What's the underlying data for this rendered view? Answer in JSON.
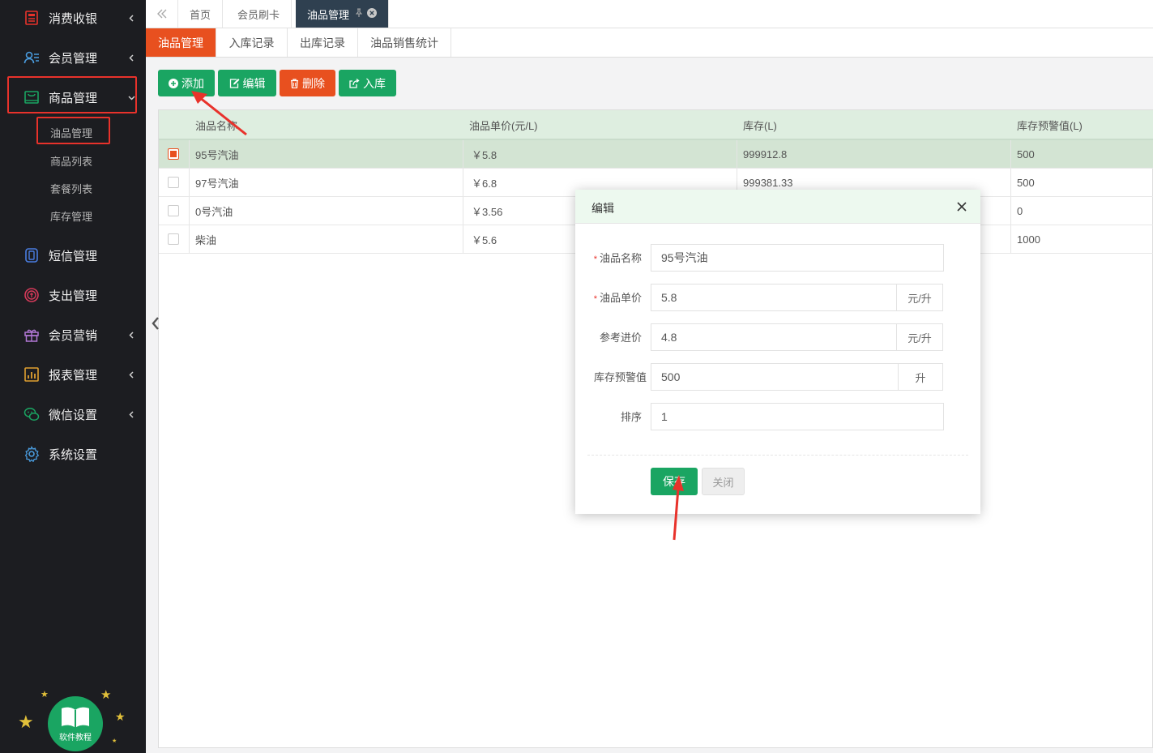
{
  "sidebar": {
    "items": [
      {
        "label": "消费收银",
        "icon": "cash-register-icon"
      },
      {
        "label": "会员管理",
        "icon": "member-icon"
      },
      {
        "label": "商品管理",
        "icon": "goods-icon"
      },
      {
        "label": "短信管理",
        "icon": "sms-icon"
      },
      {
        "label": "支出管理",
        "icon": "expense-icon"
      },
      {
        "label": "会员营销",
        "icon": "gift-icon"
      },
      {
        "label": "报表管理",
        "icon": "report-icon"
      },
      {
        "label": "微信设置",
        "icon": "wechat-icon"
      },
      {
        "label": "系统设置",
        "icon": "gear-icon"
      }
    ],
    "sub_items": [
      "油品管理",
      "商品列表",
      "套餐列表",
      "库存管理"
    ],
    "tutorial_label": "软件教程"
  },
  "top_tabs": [
    "首页",
    "会员刷卡",
    "油品管理"
  ],
  "sub_tabs": [
    "油品管理",
    "入库记录",
    "出库记录",
    "油品销售统计"
  ],
  "toolbar": {
    "add_label": "添加",
    "edit_label": "编辑",
    "delete_label": "删除",
    "stock_in_label": "入库"
  },
  "table": {
    "headers": [
      "油品名称",
      "油品单价(元/L)",
      "库存(L)",
      "库存预警值(L)"
    ],
    "rows": [
      {
        "name": "95号汽油",
        "price": "￥5.8",
        "stock": "999912.8",
        "warning": "500",
        "selected": true
      },
      {
        "name": "97号汽油",
        "price": "￥6.8",
        "stock": "999381.33",
        "warning": "500",
        "selected": false
      },
      {
        "name": "0号汽油",
        "price": "￥3.56",
        "stock": "",
        "warning": "0",
        "selected": false
      },
      {
        "name": "柴油",
        "price": "￥5.6",
        "stock": "",
        "warning": "1000",
        "selected": false
      }
    ]
  },
  "modal": {
    "title": "编辑",
    "fields": [
      {
        "label": "油品名称",
        "value": "95号汽油",
        "required": true,
        "suffix": ""
      },
      {
        "label": "油品单价",
        "value": "5.8",
        "required": true,
        "suffix": "元/升"
      },
      {
        "label": "参考进价",
        "value": "4.8",
        "required": false,
        "suffix": "元/升"
      },
      {
        "label": "库存预警值",
        "value": "500",
        "required": false,
        "suffix": "升"
      },
      {
        "label": "排序",
        "value": "1",
        "required": false,
        "suffix": ""
      }
    ],
    "required_mark": "*",
    "save_label": "保存",
    "close_label": "关闭"
  },
  "colors": {
    "sidebar_bg": "#1c1d21",
    "accent_orange": "#e8501f",
    "accent_green": "#1aa562",
    "annotation_red": "#e8322b"
  }
}
